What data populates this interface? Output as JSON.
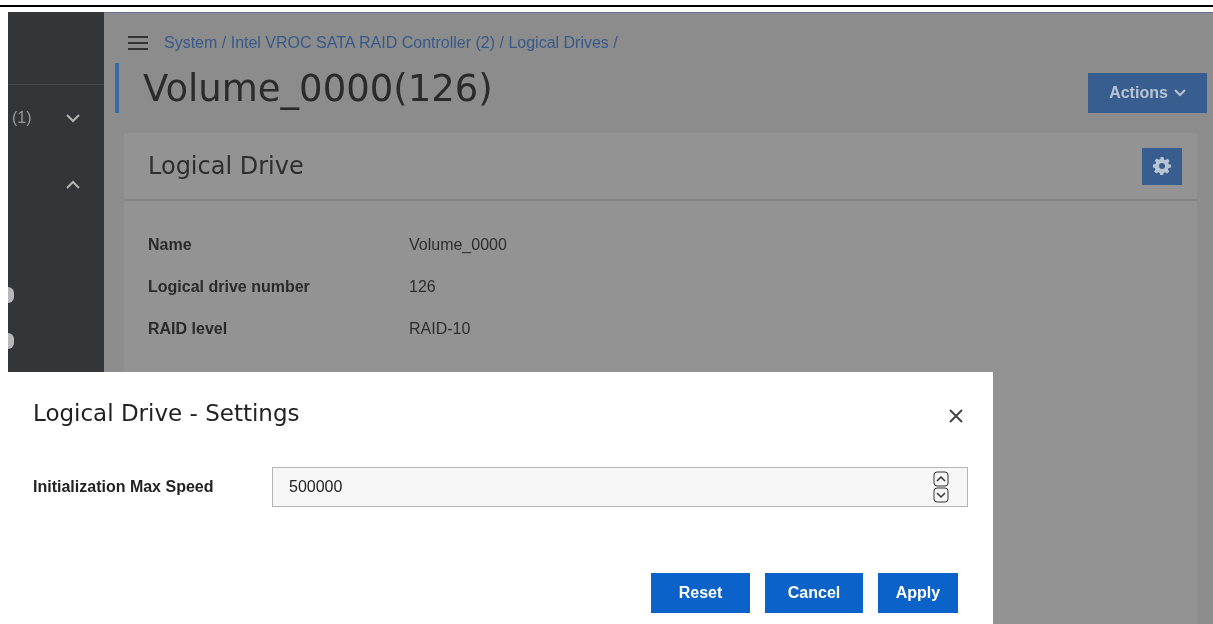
{
  "sidebar": {
    "items": [
      {
        "label": "(1)",
        "expanded": false
      },
      {
        "expanded": true
      }
    ]
  },
  "breadcrumb": "System / Intel VROC SATA RAID Controller (2) / Logical Drives /",
  "page_title": "Volume_0000(126)",
  "actions_button": "Actions",
  "card": {
    "title": "Logical Drive",
    "properties": [
      {
        "label": "Name",
        "value": "Volume_0000"
      },
      {
        "label": "Logical drive number",
        "value": "126"
      },
      {
        "label": "RAID level",
        "value": "RAID-10"
      }
    ]
  },
  "dialog": {
    "title": "Logical Drive - Settings",
    "field": {
      "label": "Initialization Max Speed",
      "value": "500000"
    },
    "buttons": [
      "Reset",
      "Cancel",
      "Apply"
    ]
  }
}
